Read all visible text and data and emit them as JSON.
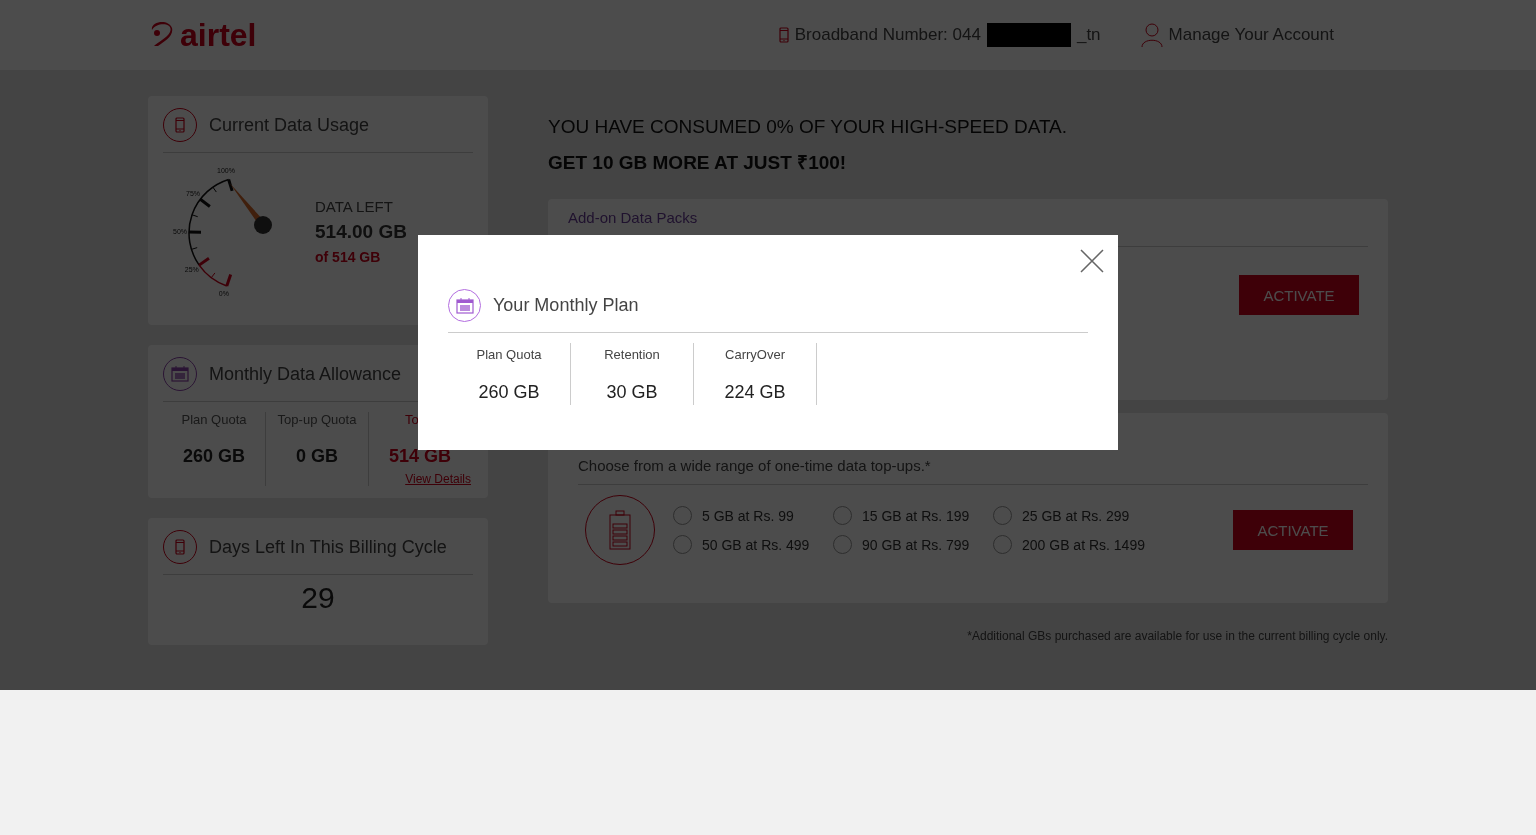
{
  "header": {
    "logo": "airtel",
    "broadband_label": "Broadband Number: 044",
    "broadband_suffix": "_tn",
    "account_link": "Manage Your Account"
  },
  "usage_card": {
    "title": "Current Data Usage",
    "gauge": {
      "ticks": [
        "100%",
        "75%",
        "50%",
        "25%",
        "0%"
      ]
    },
    "data_left_label": "DATA LEFT",
    "data_left": "514.00 GB",
    "total": "of 514 GB"
  },
  "allowance_card": {
    "title": "Monthly Data Allowance",
    "columns": [
      {
        "label": "Plan Quota",
        "value": "260 GB",
        "highlight": false
      },
      {
        "label": "Top-up Quota",
        "value": "0 GB",
        "highlight": false
      },
      {
        "label": "To",
        "value": "514 GB",
        "highlight": true
      }
    ],
    "link": "View Details"
  },
  "days_card": {
    "title": "Days Left In This Billing Cycle",
    "value": "29"
  },
  "headline": [
    "YOU HAVE CONSUMED 0% OF YOUR HIGH-SPEED DATA.",
    "GET 10 GB MORE AT JUST ₹100!"
  ],
  "addon_card": {
    "title": "Add-on Data Packs",
    "button": "ACTIVATE"
  },
  "topup_card": {
    "subtitle": "Choose from a wide range of one-time data top-ups.*",
    "options": [
      {
        "label": "5 GB at Rs. 99",
        "selected": false
      },
      {
        "label": "15 GB at Rs. 199",
        "selected": false
      },
      {
        "label": "25 GB at Rs. 299",
        "selected": false
      },
      {
        "label": "50 GB at Rs. 499",
        "selected": false
      },
      {
        "label": "90 GB at Rs. 799",
        "selected": false
      },
      {
        "label": "200 GB at Rs. 1499",
        "selected": false
      }
    ],
    "button": "ACTIVATE"
  },
  "footnote": "*Additional GBs purchased are available for use in the current billing cycle only.",
  "modal": {
    "title": "Your Monthly Plan",
    "columns": [
      {
        "label": "Plan Quota",
        "value": "260 GB"
      },
      {
        "label": "Retention",
        "value": "30 GB"
      },
      {
        "label": "CarryOver",
        "value": "224 GB"
      }
    ]
  }
}
